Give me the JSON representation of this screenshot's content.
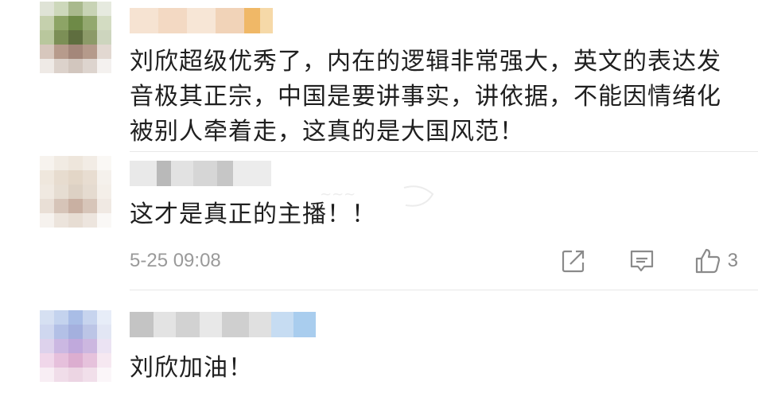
{
  "comments": [
    {
      "text": "刘欣超级优秀了，内在的逻辑非常强大，英文的表达发音极其正宗，中国是要讲事实，讲依据，不能因情绪化被别人牵着走，这真的是大国风范！"
    },
    {
      "text": "这才是真正的主播！！",
      "timestamp": "5-25 09:08",
      "likes": "3"
    },
    {
      "text": "刘欣加油！"
    }
  ],
  "icons": {
    "share": "share-icon",
    "reply": "comment-icon",
    "like": "thumbs-up-icon"
  },
  "colors": {
    "text": "#1f1f1f",
    "meta": "#9a9a9a",
    "icon": "#8a8a8a",
    "divider": "#e8e8e8"
  }
}
